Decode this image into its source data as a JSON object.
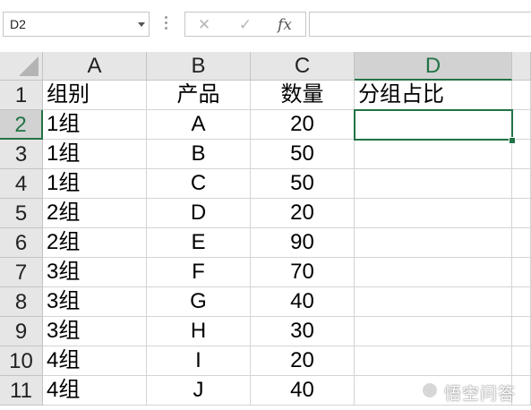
{
  "formula_bar": {
    "name_box": "D2",
    "cancel_icon": "✕",
    "enter_icon": "✓",
    "function_icon": "fx",
    "formula": ""
  },
  "columns": [
    "A",
    "B",
    "C",
    "D"
  ],
  "active_column": "D",
  "active_row": "2",
  "rows": [
    {
      "num": "1",
      "a": "组别",
      "b": "产品",
      "c": "数量",
      "d": "分组占比"
    },
    {
      "num": "2",
      "a": "1组",
      "b": "A",
      "c": "20",
      "d": ""
    },
    {
      "num": "3",
      "a": "1组",
      "b": "B",
      "c": "50",
      "d": ""
    },
    {
      "num": "4",
      "a": "1组",
      "b": "C",
      "c": "50",
      "d": ""
    },
    {
      "num": "5",
      "a": "2组",
      "b": "D",
      "c": "20",
      "d": ""
    },
    {
      "num": "6",
      "a": "2组",
      "b": "E",
      "c": "90",
      "d": ""
    },
    {
      "num": "7",
      "a": "3组",
      "b": "F",
      "c": "70",
      "d": ""
    },
    {
      "num": "8",
      "a": "3组",
      "b": "G",
      "c": "40",
      "d": ""
    },
    {
      "num": "9",
      "a": "3组",
      "b": "H",
      "c": "30",
      "d": ""
    },
    {
      "num": "10",
      "a": "4组",
      "b": "I",
      "c": "20",
      "d": ""
    },
    {
      "num": "11",
      "a": "4组",
      "b": "J",
      "c": "40",
      "d": ""
    }
  ],
  "selected_cell": "D2",
  "watermark": "悟空问答",
  "colors": {
    "accent": "#217346",
    "header_bg": "#e6e6e6",
    "gridline": "#d4d4d4"
  }
}
